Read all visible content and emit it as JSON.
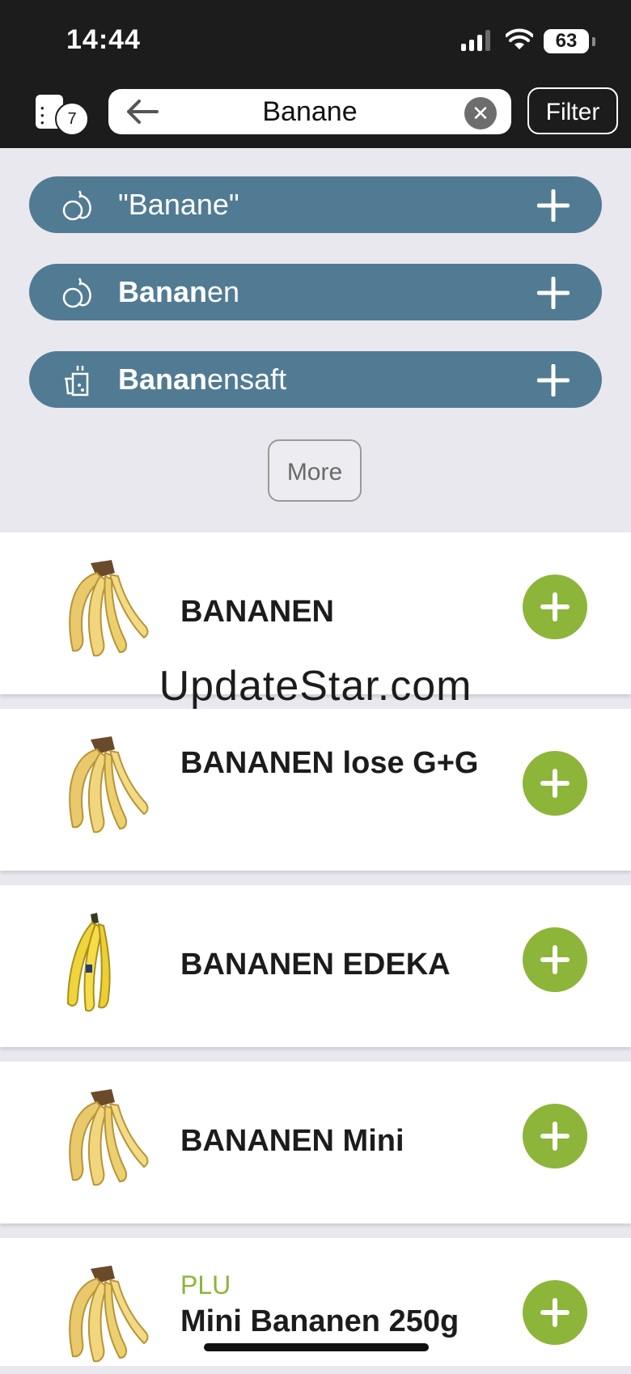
{
  "status": {
    "time": "14:44",
    "battery": "63"
  },
  "header": {
    "list_count": "7",
    "search_value": "Banane",
    "filter_label": "Filter"
  },
  "suggestions": [
    {
      "icon": "fruit-icon",
      "text_bold": "",
      "text_rest": "\"Banane\""
    },
    {
      "icon": "fruit-icon",
      "text_bold": "Banan",
      "text_rest": "en"
    },
    {
      "icon": "juice-icon",
      "text_bold": "Banan",
      "text_rest": "ensaft"
    }
  ],
  "more_label": "More",
  "products": [
    {
      "name": "BANANEN",
      "plu": ""
    },
    {
      "name": "BANANEN lose G+G",
      "plu": ""
    },
    {
      "name": "BANANEN EDEKA",
      "plu": ""
    },
    {
      "name": "BANANEN Mini",
      "plu": ""
    },
    {
      "name": "Mini Bananen 250g",
      "plu": "PLU"
    }
  ],
  "watermark": "UpdateStar.com",
  "colors": {
    "suggestion_bg": "#517b93",
    "add_button": "#8db53a",
    "topbar": "#1c1c1c"
  }
}
